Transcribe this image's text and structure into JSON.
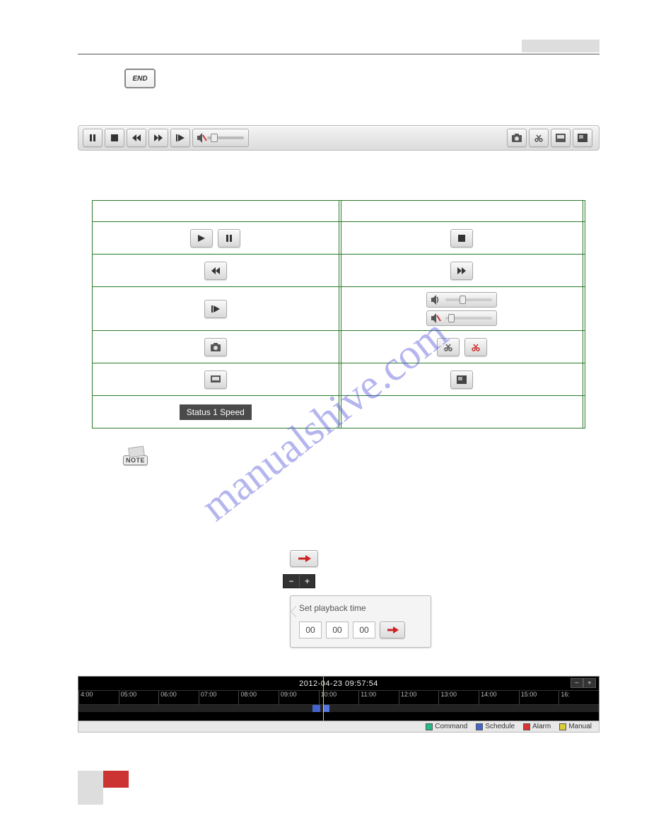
{
  "end_icon_label": "END",
  "note_icon_label": "NOTE",
  "status_label": "Status   1 Speed",
  "popup": {
    "title": "Set playback time",
    "h": "00",
    "m": "00",
    "s": "00"
  },
  "timeline": {
    "timestamp": "2012-04-23 09:57:54",
    "ticks": [
      "4:00",
      "05:00",
      "06:00",
      "07:00",
      "08:00",
      "09:00",
      "10:00",
      "11:00",
      "12:00",
      "13:00",
      "14:00",
      "15:00",
      "16:"
    ],
    "legend": {
      "command": "Command",
      "schedule": "Schedule",
      "alarm": "Alarm",
      "manual": "Manual"
    }
  },
  "watermark": "manualshive.com"
}
